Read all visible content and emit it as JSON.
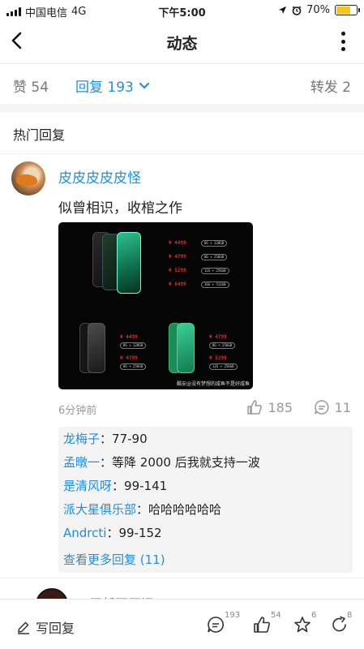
{
  "status_bar": {
    "carrier": "中国电信",
    "network": "4G",
    "time": "下午5:00",
    "battery": "70%",
    "battery_level": 0.7
  },
  "nav": {
    "title": "动态"
  },
  "tabs": {
    "likes": "赞 54",
    "replies": "回复 193",
    "reposts": "转发 2"
  },
  "section_title": "热门回复",
  "comment": {
    "username": "皮皮皮皮皮怪",
    "text": "似曾相识，收棺之作",
    "time": "6分钟前",
    "likes": "185",
    "replies": "11",
    "image": {
      "prices_top": [
        "¥ 4499",
        "¥ 4799",
        "¥ 5299",
        "¥ 6499"
      ],
      "specs_top": [
        "8G + 128GB",
        "8G + 256GB",
        "12G + 256GB",
        "16G + 512GB"
      ],
      "prices_bl": [
        "¥ 4499",
        "¥ 4799"
      ],
      "specs_bl": [
        "8G + 128GB",
        "8G + 256GB"
      ],
      "prices_br": [
        "¥ 4799",
        "¥ 5299"
      ],
      "specs_br": [
        "8G + 256GB",
        "12G + 256GB"
      ],
      "watermark": "酷安@没有梦想的咸鱼不是好咸鱼"
    },
    "sub_replies": [
      {
        "user": "龙梅子",
        "text": "77-90"
      },
      {
        "user": "孟暾一",
        "text": "等降 2000 后我就支持一波"
      },
      {
        "user": "是清风呀",
        "text": "99-141"
      },
      {
        "user": "派大星俱乐部",
        "text": "哈哈哈哈哈哈"
      },
      {
        "user": "Andrcti",
        "text": "99-152"
      }
    ],
    "more_link": "查看更多回复 (11)"
  },
  "next_comment": {
    "username": "买新不买旧 ›"
  },
  "bottom_bar": {
    "write_label": "写回复",
    "comment_count": "193",
    "like_count": "54",
    "star_count": "6",
    "share_count": "8"
  },
  "colors": {
    "accent": "#1e8ee6",
    "battery": "#f5c518",
    "price": "#e32b2b"
  }
}
